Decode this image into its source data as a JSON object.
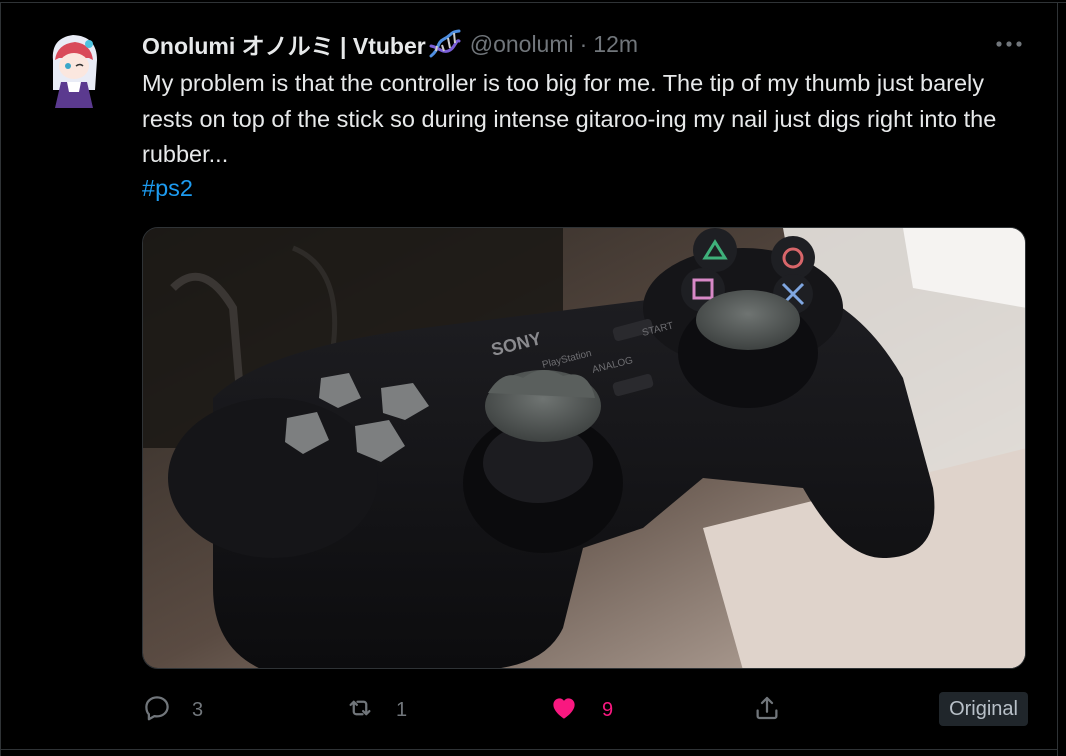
{
  "tweet": {
    "author_name": "Onolumi オノルミ | Vtuber",
    "author_badge_icon": "dna-emoji-icon",
    "handle": "@onolumi",
    "separator": "·",
    "time": "12m",
    "text": "My problem is that the controller is too big for me. The tip of my  thumb just barely rests on top of the stick so during intense gitaroo-ing my nail just digs right into the rubber...",
    "hashtag": "#ps2",
    "media_description_icon": "photo",
    "more_icon": "ellipsis-icon"
  },
  "actions": {
    "reply_count": "3",
    "retweet_count": "1",
    "like_count": "9",
    "original_label": "Original",
    "icons": [
      "reply-icon",
      "retweet-icon",
      "heart-icon",
      "share-icon"
    ]
  },
  "photo_printed_text": {
    "brand": "SONY",
    "label_playstation": "PlayStation",
    "label_analog": "ANALOG",
    "label_start": "START"
  },
  "colors": {
    "background": "#000000",
    "text": "#e7e9ea",
    "muted": "#71767b",
    "link": "#1d9bf0",
    "like": "#f91880"
  }
}
